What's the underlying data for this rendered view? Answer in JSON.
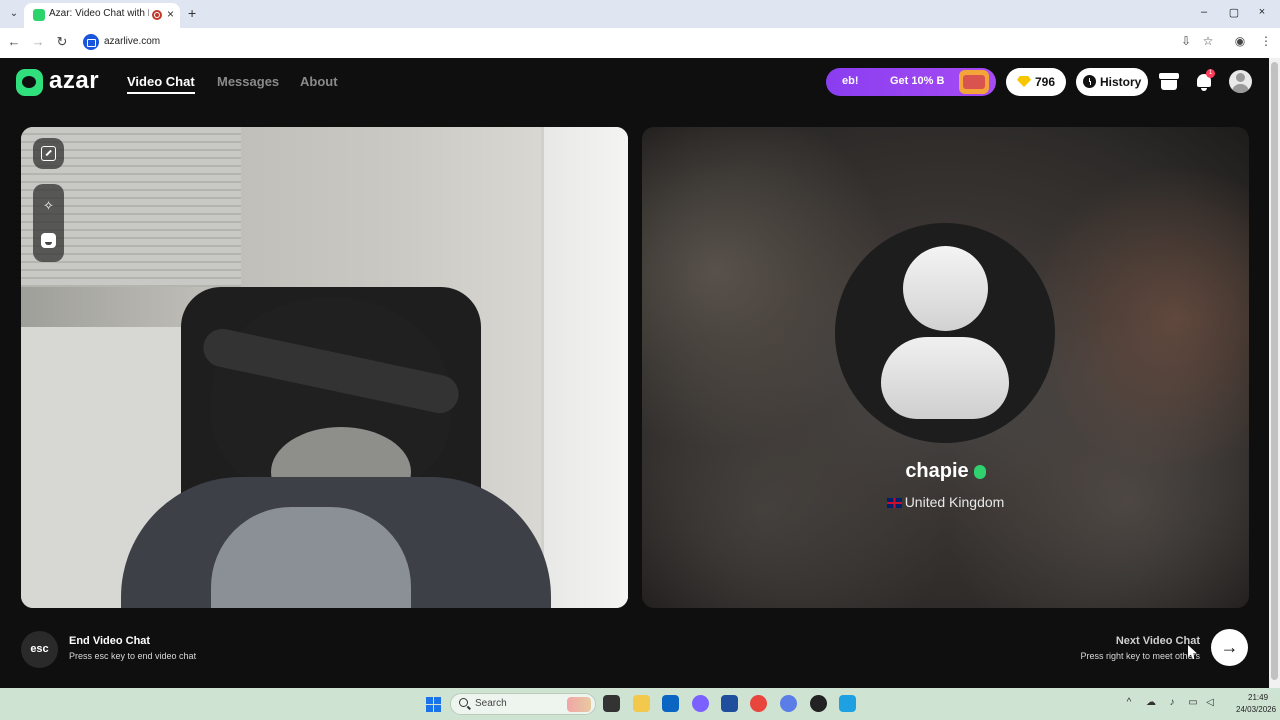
{
  "browser": {
    "tab_title": "Azar: Video Chat with New",
    "url": "azarlive.com",
    "tab_close": "×",
    "new_tab": "+",
    "minimize": "–",
    "maximize": "▢",
    "close": "×"
  },
  "header": {
    "logo": "azar",
    "nav": [
      {
        "label": "Video Chat",
        "active": true
      },
      {
        "label": "Messages",
        "active": false
      },
      {
        "label": "About",
        "active": false
      }
    ],
    "promo_left": "eb!",
    "promo_right": "Get 10% B",
    "gems": "796",
    "history_label": "History",
    "notification_count": "1"
  },
  "remote": {
    "name": "chapie",
    "country": "United Kingdom"
  },
  "controls": {
    "esc_label": "esc",
    "end_title": "End Video Chat",
    "end_sub": "Press esc key to end video chat",
    "next_title": "Next Video Chat",
    "next_sub": "Press right key to meet others",
    "next_arrow": "→"
  },
  "taskbar": {
    "search_placeholder": "Search",
    "time": "21:49",
    "date": "24/03/2026"
  },
  "colors": {
    "brand": "#2fe07d",
    "promo": "#8a3ef0",
    "background": "#0f0f0f"
  }
}
